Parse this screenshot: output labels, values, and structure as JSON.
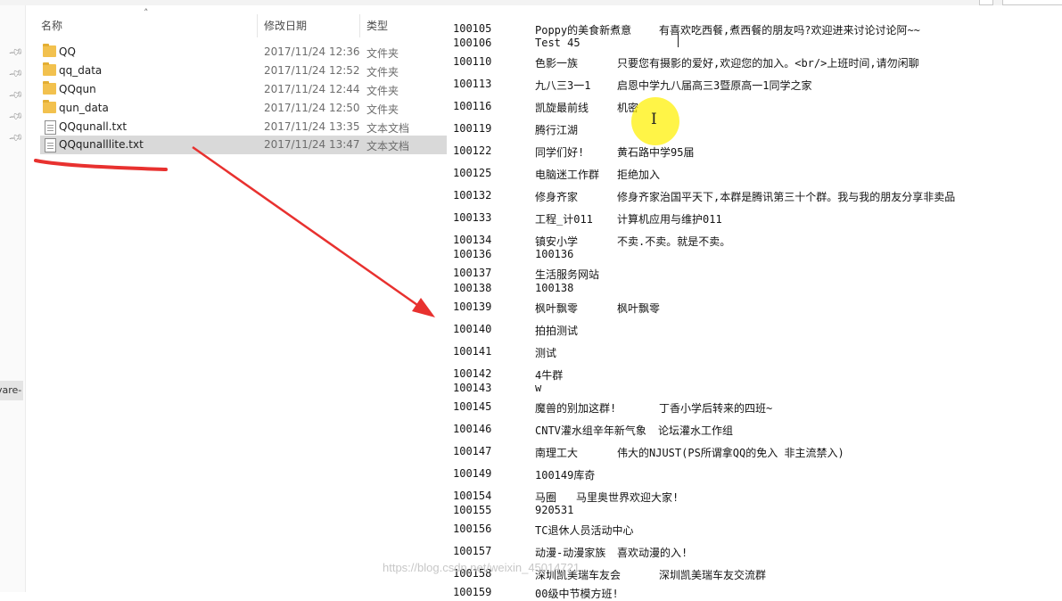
{
  "explorer": {
    "columns": {
      "name": "名称",
      "date": "修改日期",
      "type": "类型"
    },
    "files": [
      {
        "name": "QQ",
        "date": "2017/11/24 12:36",
        "type": "文件夹",
        "kind": "folder"
      },
      {
        "name": "qq_data",
        "date": "2017/11/24 12:52",
        "type": "文件夹",
        "kind": "folder"
      },
      {
        "name": "QQqun",
        "date": "2017/11/24 12:44",
        "type": "文件夹",
        "kind": "folder"
      },
      {
        "name": "qun_data",
        "date": "2017/11/24 12:50",
        "type": "文件夹",
        "kind": "folder"
      },
      {
        "name": "QQqunall.txt",
        "date": "2017/11/24 13:35",
        "type": "文本文档",
        "kind": "txt"
      },
      {
        "name": "QQqunalllite.txt",
        "date": "2017/11/24 13:47",
        "type": "文本文档",
        "kind": "txt",
        "selected": true
      }
    ]
  },
  "nav": {
    "label": "vare-"
  },
  "icons": {
    "pin": "pin-icon",
    "folder": "folder-icon",
    "text_file": "text-file-icon",
    "text_cursor": "i-beam-cursor-icon"
  },
  "colors": {
    "selection": "#d9d9d9",
    "annotation": "#e8312f",
    "cursor_highlight": "#fff000",
    "folder": "#f2c14e"
  },
  "notepad": {
    "lines": [
      {
        "id": "100105",
        "name": "Poppy的美食新煮意",
        "desc": "有喜欢吃西餐,煮西餐的朋友吗?欢迎进来讨论讨论阿~~"
      },
      {
        "id": "100106",
        "name": "Test  45",
        "desc": ""
      },
      {
        "id": "100110",
        "name": "色影一族",
        "desc": "只要您有摄影的爱好,欢迎您的加入。<br/>上班时间,请勿闲聊"
      },
      {
        "id": "100113",
        "name": "九八三3一1",
        "desc": "启恩中学九八届高三3暨原高一1同学之家"
      },
      {
        "id": "100116",
        "name": "凯旋最前线",
        "desc": "机密"
      },
      {
        "id": "100119",
        "name": "腾行江湖",
        "desc": ""
      },
      {
        "id": "100122",
        "name": "同学们好!",
        "desc": "黄石路中学95届"
      },
      {
        "id": "100125",
        "name": "电脑迷工作群",
        "desc": "拒绝加入"
      },
      {
        "id": "100132",
        "name": "修身齐家",
        "desc": "修身齐家治国平天下,本群是腾讯第三十个群。我与我的朋友分享非卖品"
      },
      {
        "id": "100133",
        "name": "工程_计011",
        "desc": "计算机应用与维护011"
      },
      {
        "id": "100134",
        "name": "镇安小学",
        "desc": "不卖.不卖。就是不卖。"
      },
      {
        "id": "100136",
        "name": "100136",
        "desc": ""
      },
      {
        "id": "100137",
        "name": "生活服务网站",
        "desc": ""
      },
      {
        "id": "100138",
        "name": "100138",
        "desc": ""
      },
      {
        "id": "100139",
        "name": "枫叶飘零",
        "desc": "枫叶飘零"
      },
      {
        "id": "100140",
        "name": "拍拍测试",
        "desc": ""
      },
      {
        "id": "100141",
        "name": "测试",
        "desc": ""
      },
      {
        "id": "100142",
        "name": "4牛群",
        "desc": ""
      },
      {
        "id": "100143",
        "name": "w",
        "desc": ""
      },
      {
        "id": "100145",
        "name": "魔兽的别加这群!",
        "desc": "丁香小学后转来的四班~"
      },
      {
        "id": "100146",
        "name": "CNTV灌水组辛年新气象",
        "desc": "论坛灌水工作组"
      },
      {
        "id": "100147",
        "name": "南理工大",
        "desc": "伟大的NJUST(PS所谓拿QQ的免入  非主流禁入)"
      },
      {
        "id": "100149",
        "name": "100149库奇",
        "desc": ""
      },
      {
        "id": "100154",
        "name": "马圈",
        "desc": "马里奥世界欢迎大家!"
      },
      {
        "id": "100155",
        "name": "920531",
        "desc": ""
      },
      {
        "id": "100156",
        "name": "TC退休人员活动中心",
        "desc": ""
      },
      {
        "id": "100157",
        "name": "动漫-动漫家族",
        "desc": "喜欢动漫的入!"
      },
      {
        "id": "100158",
        "name": "深圳凯美瑞车友会",
        "desc": "深圳凯美瑞车友交流群"
      },
      {
        "id": "100159",
        "name": "00级中节模方班!",
        "desc": ""
      }
    ]
  },
  "watermark": "https://blog.csdn.net/weixin_45014721"
}
